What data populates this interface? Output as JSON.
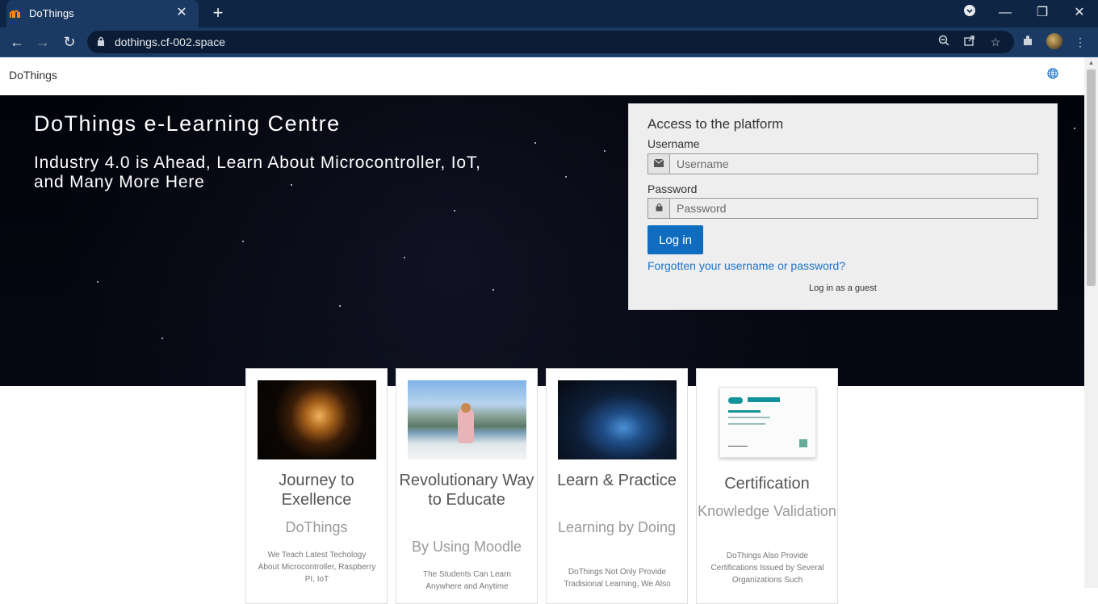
{
  "browser": {
    "tab_title": "DoThings",
    "tab_favicon": "moodle-m-icon",
    "url": "dothings.cf-002.space"
  },
  "site": {
    "brand": "DoThings",
    "language_icon": "globe-icon"
  },
  "hero": {
    "title": "DoThings e-Learning Centre",
    "subtitle": "Industry 4.0 is Ahead, Learn About Microcontroller, IoT, and Many More Here"
  },
  "login": {
    "heading": "Access to the platform",
    "username_label": "Username",
    "username_placeholder": "Username",
    "password_label": "Password",
    "password_placeholder": "Password",
    "login_button": "Log in",
    "forgot_link": "Forgotten your username or password?",
    "guest_link": "Log in as a guest"
  },
  "cards": [
    {
      "title": "Journey to Exellence",
      "subtitle": "DoThings",
      "description": "We Teach Latest Techology About Microcontroller, Raspberry PI, IoT"
    },
    {
      "title": "Revolutionary Way to Educate",
      "subtitle": "By Using Moodle",
      "description": "The Students Can Learn Anywhere and Anytime"
    },
    {
      "title": "Learn & Practice",
      "subtitle": "Learning by Doing",
      "description": "DoThings Not Only Provide Tradisional Learning, We Also"
    },
    {
      "title": "Certification",
      "subtitle": "Knowledge Validation",
      "description": "DoThings Also Provide Certifications Issued by Several Organizations Such"
    }
  ],
  "colors": {
    "titlebar": "#0f2545",
    "toolbar": "#1b3a63",
    "primary_button": "#0f6cbf",
    "link": "#1d73c9"
  }
}
